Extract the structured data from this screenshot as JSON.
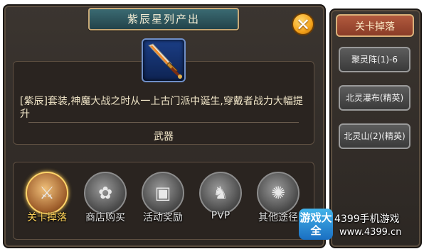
{
  "window": {
    "title": "紫辰星列产出",
    "close_symbol": "✕"
  },
  "item": {
    "icon": "sword-icon",
    "description": "[紫辰]套装,神魔大战之时从一上古门派中诞生,穿戴者战力大幅提升",
    "type": "武器"
  },
  "sources": [
    {
      "label": "关卡掉落",
      "icon": "crossed-swords-icon",
      "glyph": "⚔",
      "active": true
    },
    {
      "label": "商店购买",
      "icon": "shop-bag-icon",
      "glyph": "✿",
      "active": false
    },
    {
      "label": "活动奖励",
      "icon": "treasure-chest-icon",
      "glyph": "▣",
      "active": false
    },
    {
      "label": "PVP",
      "icon": "pvp-helmet-icon",
      "glyph": "♞",
      "active": false
    },
    {
      "label": "其他途径",
      "icon": "wheel-icon",
      "glyph": "✺",
      "active": false
    }
  ],
  "drop_panel": {
    "header": "关卡掉落",
    "stages": [
      "聚灵阵(1)-6",
      "北灵瀑布(精英)",
      "北灵山(2)(精英)"
    ]
  },
  "watermark": {
    "logo_text": "游戏大全",
    "site": "4399手机游戏",
    "url": "www.4399.cn"
  }
}
